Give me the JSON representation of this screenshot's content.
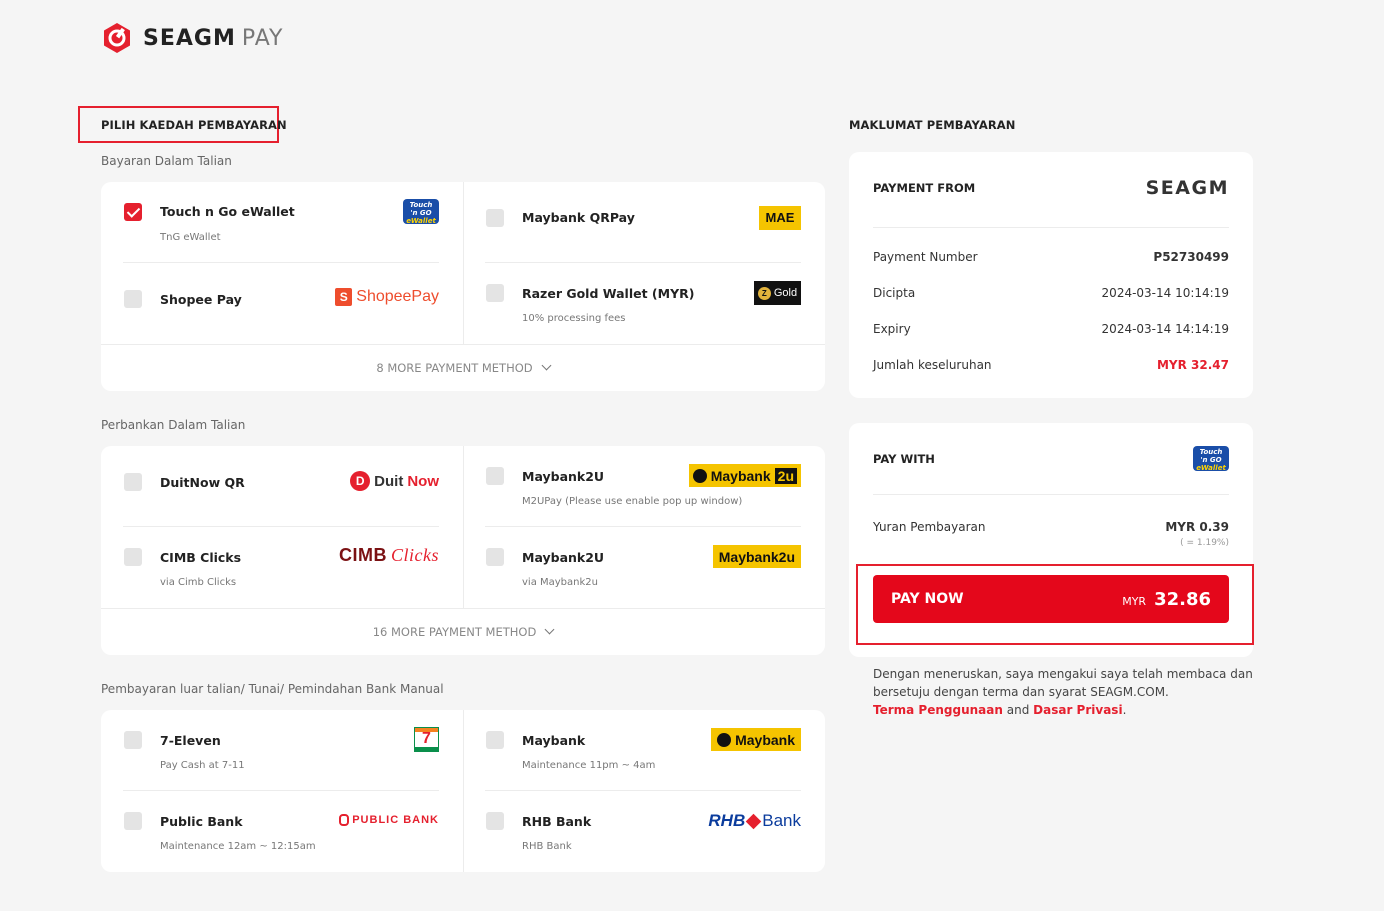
{
  "brand": {
    "name": "SEAGM",
    "pay": "PAY",
    "accent": "#e5202e"
  },
  "left": {
    "section_title": "PILIH KAEDAH PEMBAYARAN",
    "groups": [
      {
        "label": "Bayaran Dalam Talian",
        "items": [
          {
            "name": "Touch n Go eWallet",
            "sub": "TnG eWallet",
            "checked": true,
            "logo": "tng-logo"
          },
          {
            "name": "Maybank QRPay",
            "sub": "",
            "checked": false,
            "logo": "mae-logo"
          },
          {
            "name": "Shopee Pay",
            "sub": "",
            "checked": false,
            "logo": "shopeepay-logo"
          },
          {
            "name": "Razer Gold Wallet (MYR)",
            "sub": "10% processing fees",
            "checked": false,
            "logo": "razer-gold-logo"
          }
        ],
        "more": "8 MORE PAYMENT METHOD"
      },
      {
        "label": "Perbankan Dalam Talian",
        "items": [
          {
            "name": "DuitNow QR",
            "sub": "",
            "checked": false,
            "logo": "duitnow-logo"
          },
          {
            "name": "Maybank2U",
            "sub": "M2UPay (Please use enable pop up window)",
            "checked": false,
            "logo": "maybank2u-logo"
          },
          {
            "name": "CIMB Clicks",
            "sub": "via Cimb Clicks",
            "checked": false,
            "logo": "cimb-clicks-logo"
          },
          {
            "name": "Maybank2U",
            "sub": "via Maybank2u",
            "checked": false,
            "logo": "maybank2u-logo"
          }
        ],
        "more": "16 MORE PAYMENT METHOD"
      },
      {
        "label": "Pembayaran luar talian/ Tunai/ Pemindahan Bank Manual",
        "items": [
          {
            "name": "7-Eleven",
            "sub": "Pay Cash at 7-11",
            "checked": false,
            "logo": "seven-eleven-logo"
          },
          {
            "name": "Maybank",
            "sub": "Maintenance 11pm ~ 4am",
            "checked": false,
            "logo": "maybank-logo"
          },
          {
            "name": "Public Bank",
            "sub": "Maintenance 12am ~ 12:15am",
            "checked": false,
            "logo": "public-bank-logo"
          },
          {
            "name": "RHB Bank",
            "sub": "RHB Bank",
            "checked": false,
            "logo": "rhb-bank-logo"
          }
        ]
      }
    ],
    "logo_text": {
      "tng_top": "Touch",
      "tng_mid": "'n GO",
      "tng_bot": "eWallet",
      "shopee": "ShopeePay",
      "mae": "MAE",
      "razer_coin": "Z",
      "razer": "Gold",
      "duitnow_a": "Duit",
      "duitnow_b": "Now",
      "maybank": "Maybank",
      "m2u": "2u",
      "maybank2u": "Maybank2u",
      "cimb_a": "CIMB",
      "cimb_b": "Clicks",
      "seven": "7",
      "public_bank": "PUBLIC BANK",
      "rhb_a": "RHB",
      "rhb_b": "Bank"
    }
  },
  "right": {
    "section_title": "MAKLUMAT PEMBAYARAN",
    "payment_from": "PAYMENT FROM",
    "merchant": "SEAGM",
    "details": [
      {
        "label": "Payment Number",
        "value": "P52730499",
        "style": "bold"
      },
      {
        "label": "Dicipta",
        "value": "2024-03-14 10:14:19",
        "style": ""
      },
      {
        "label": "Expiry",
        "value": "2024-03-14 14:14:19",
        "style": ""
      },
      {
        "label": "Jumlah keseluruhan",
        "value": "MYR 32.47",
        "style": "red"
      }
    ],
    "pay_with": "PAY WITH",
    "fee_label": "Yuran Pembayaran",
    "fee_value": "MYR 0.39",
    "fee_note": "( = 1.19%)",
    "pay_now": {
      "label": "PAY NOW",
      "currency": "MYR",
      "amount": "32.86"
    },
    "legal": {
      "text": "Dengan meneruskan, saya mengakui saya telah membaca dan bersetuju dengan terma dan syarat SEAGM.COM.",
      "terms": "Terma Penggunaan",
      "and": "and",
      "privacy": "Dasar Privasi",
      "end": "."
    }
  }
}
